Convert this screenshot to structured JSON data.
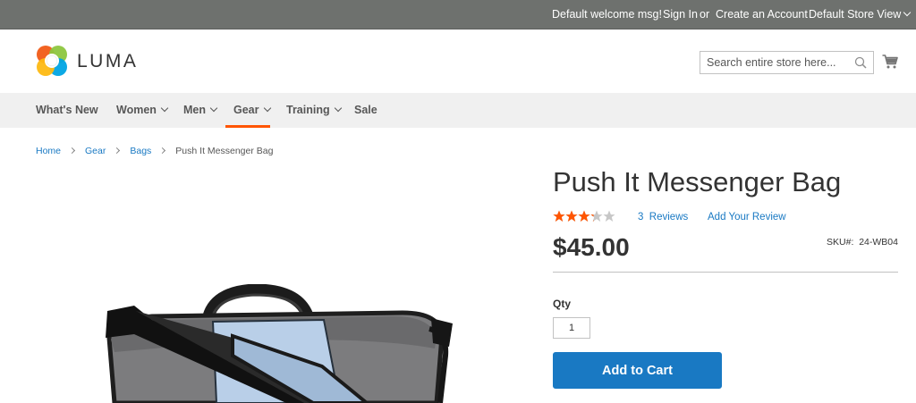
{
  "topbar": {
    "welcome": "Default welcome msg!",
    "sign_in": "Sign In",
    "or": "or",
    "create_account": "Create an Account",
    "store_view": "Default Store View"
  },
  "header": {
    "logo_text": "LUMA",
    "search_placeholder": "Search entire store here...",
    "search_value": ""
  },
  "nav": {
    "items": [
      {
        "label": "What's New",
        "has_submenu": false
      },
      {
        "label": "Women",
        "has_submenu": true
      },
      {
        "label": "Men",
        "has_submenu": true
      },
      {
        "label": "Gear",
        "has_submenu": true,
        "active": true
      },
      {
        "label": "Training",
        "has_submenu": true
      },
      {
        "label": "Sale",
        "has_submenu": false
      }
    ],
    "active_color": "#ff5501"
  },
  "breadcrumbs": [
    {
      "label": "Home",
      "link": true
    },
    {
      "label": "Gear",
      "link": true
    },
    {
      "label": "Bags",
      "link": true
    },
    {
      "label": "Push It Messenger Bag",
      "link": false
    }
  ],
  "product": {
    "title": "Push It Messenger Bag",
    "rating_fraction": 0.65,
    "reviews_count": "3",
    "reviews_label": "Reviews",
    "add_review": "Add Your Review",
    "price": "$45.00",
    "sku_label": "SKU#:",
    "sku_value": "24-WB04",
    "qty_label": "Qty",
    "qty_value": "1",
    "add_to_cart": "Add to Cart"
  },
  "colors": {
    "topbar_bg": "#6e716e",
    "link": "#1979c3",
    "button": "#1979c3",
    "star": "#ff5501",
    "star_empty": "#c7c7c7"
  }
}
